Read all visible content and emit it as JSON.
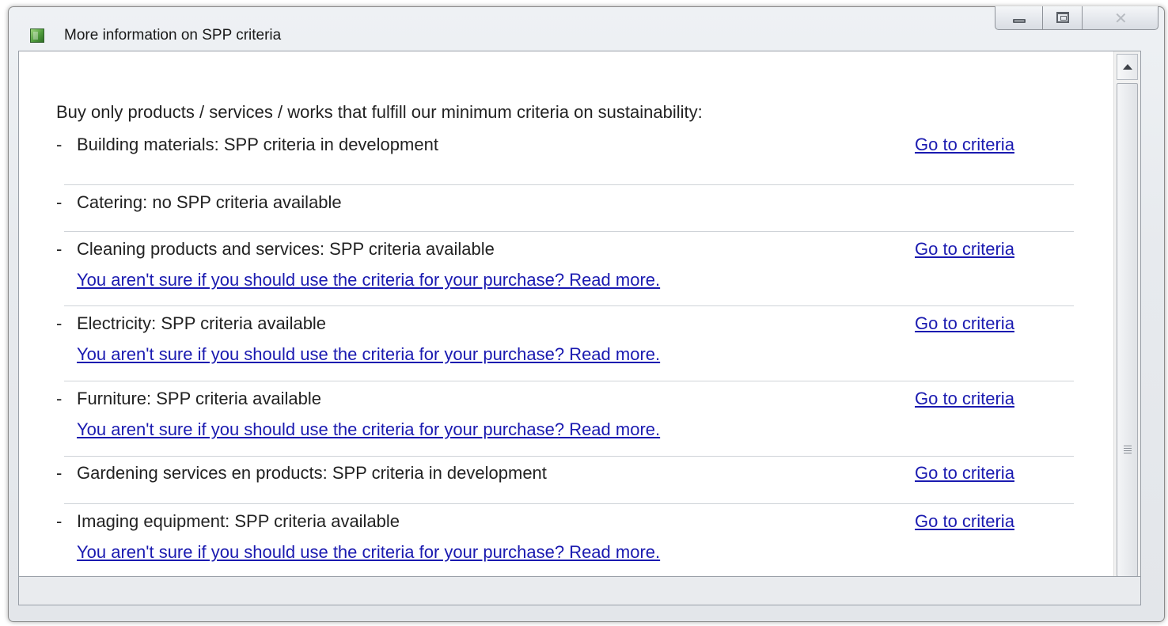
{
  "window": {
    "title": "More information on SPP criteria",
    "icon": "green-book-icon",
    "controls": [
      "minimize",
      "maximize",
      "close"
    ]
  },
  "content": {
    "intro": "Buy only products / services / works that fulfill our minimum criteria on sustainability:",
    "dash": "-",
    "items": [
      {
        "label": "Building materials: SPP criteria in development",
        "criteria_link": "Go to criteria",
        "read_more": null
      },
      {
        "label": "Catering: no SPP criteria available",
        "criteria_link": null,
        "read_more": null
      },
      {
        "label": "Cleaning products and services: SPP criteria available",
        "criteria_link": "Go to criteria",
        "read_more": "You aren't sure if you should use the criteria for your purchase? Read more."
      },
      {
        "label": "Electricity: SPP criteria available",
        "criteria_link": "Go to criteria",
        "read_more": "You aren't sure if you should use the criteria for your purchase? Read more."
      },
      {
        "label": "Furniture: SPP criteria available",
        "criteria_link": "Go to criteria",
        "read_more": "You aren't sure if you should use the criteria for your purchase? Read more."
      },
      {
        "label": "Gardening services en products: SPP criteria in development",
        "criteria_link": "Go to criteria",
        "read_more": null
      },
      {
        "label": "Imaging equipment: SPP criteria available",
        "criteria_link": "Go to criteria",
        "read_more": "You aren't sure if you should use the criteria for your purchase? Read more."
      }
    ]
  },
  "colors": {
    "link": "#1a1ab0",
    "text": "#222222",
    "separator": "#cfd3d8"
  }
}
